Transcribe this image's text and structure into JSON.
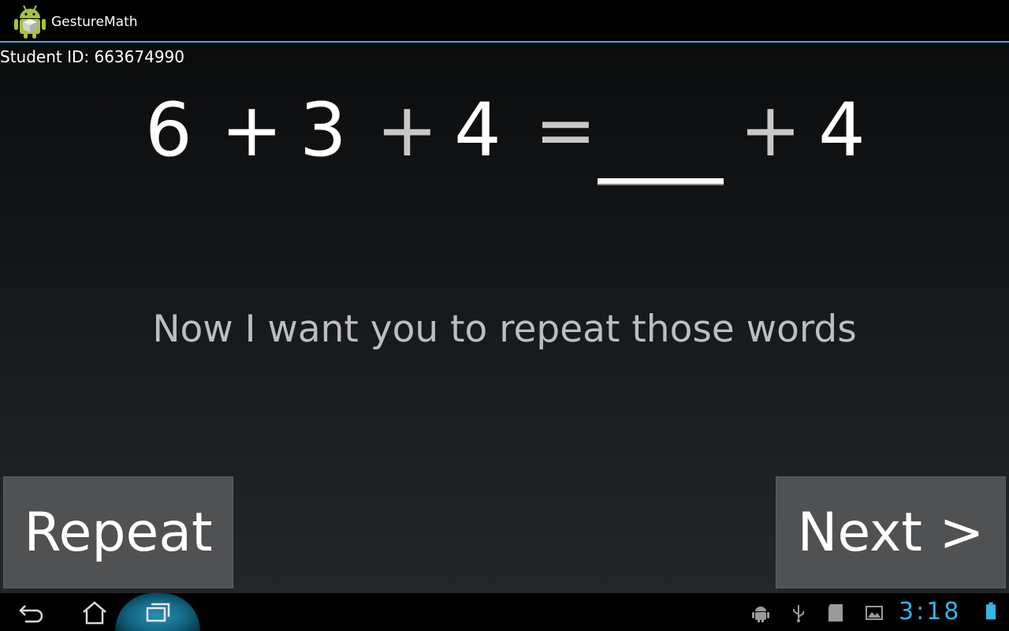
{
  "app": {
    "title": "GestureMath",
    "icon": "android-robot-icon"
  },
  "student": {
    "id_label": "Student ID: 663674990"
  },
  "equation": {
    "terms": [
      "6",
      "+",
      "3",
      "+",
      "4",
      "=",
      "+",
      "4"
    ],
    "blank": "answer-blank"
  },
  "prompt": {
    "text": "Now I want you to repeat those words"
  },
  "buttons": {
    "repeat_label": "Repeat",
    "next_label": "Next >"
  },
  "system_bar": {
    "nav": [
      "back-icon",
      "home-icon",
      "recent-apps-icon"
    ],
    "status_icons": [
      "android-debug-icon",
      "usb-icon",
      "sd-card-icon",
      "gallery-icon",
      "battery-icon"
    ],
    "clock": "3:18"
  },
  "colors": {
    "accent": "#33b5e5",
    "button_bg": "#4f5153",
    "prompt_text": "#bdbdbd"
  }
}
